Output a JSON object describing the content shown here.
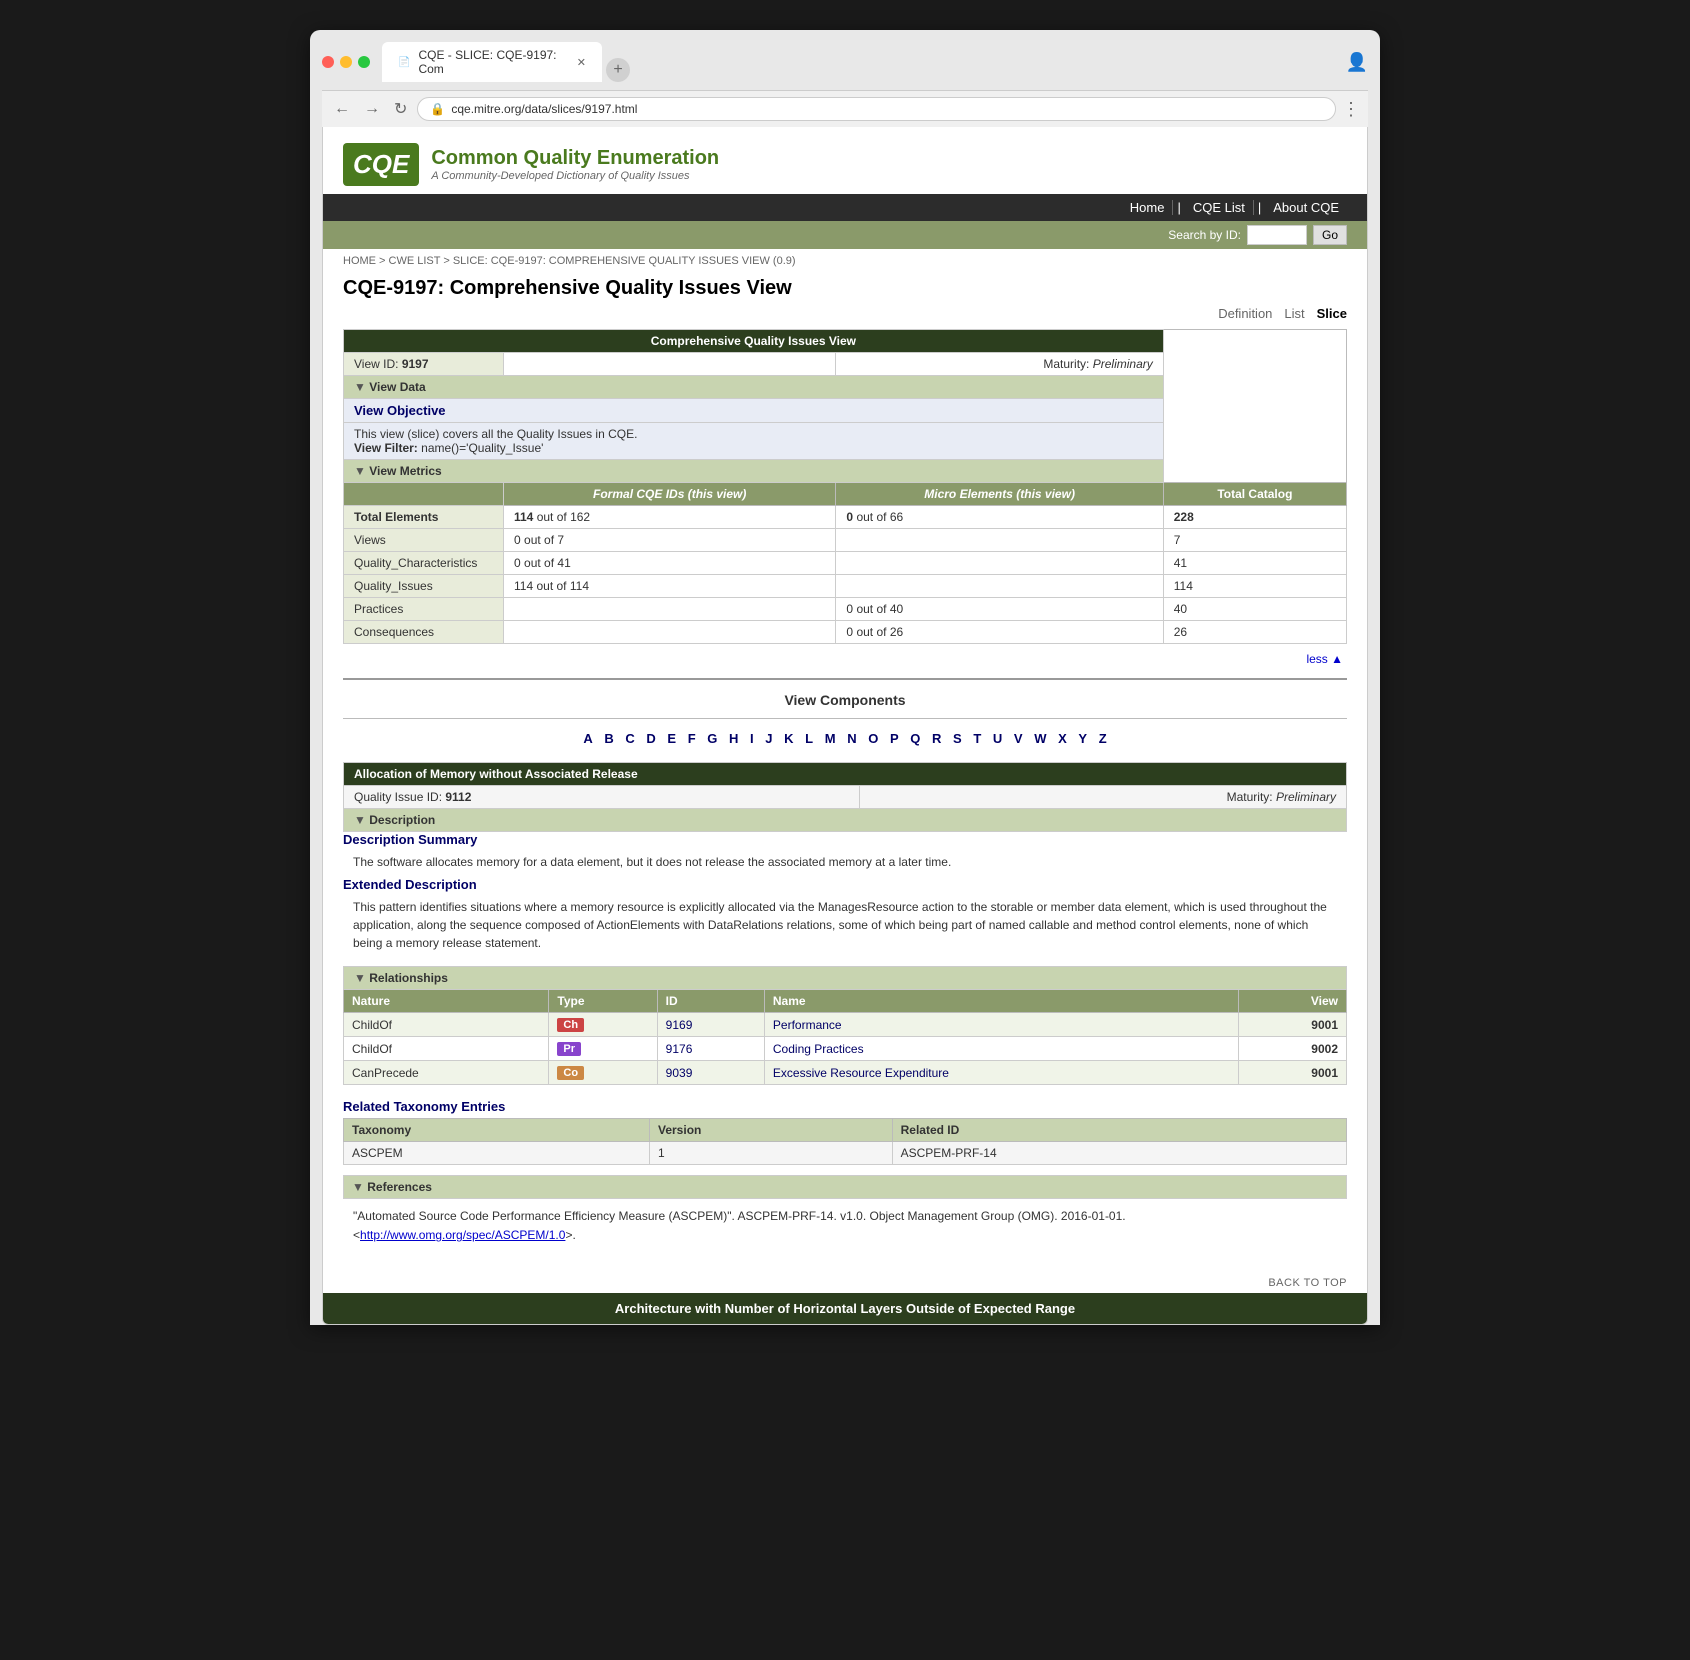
{
  "browser": {
    "tab_title": "CQE - SLICE: CQE-9197: Com",
    "url": "cqe.mitre.org/data/slices/9197.html",
    "favicon_label": "📄"
  },
  "site": {
    "logo_text": "CQE",
    "org_name": "Common Quality Enumeration",
    "org_tagline": "A Community-Developed Dictionary of Quality Issues",
    "nav_items": [
      "Home",
      "CQE List",
      "About CQE"
    ],
    "search_label": "Search by ID:",
    "search_go": "Go"
  },
  "breadcrumb": "HOME > CWE LIST > SLICE: CQE-9197: COMPREHENSIVE QUALITY ISSUES VIEW (0.9)",
  "page_title": "CQE-9197: Comprehensive Quality Issues View",
  "view_tabs": [
    "Definition",
    "List",
    "Slice"
  ],
  "main_table_title": "Comprehensive Quality Issues View",
  "view_id_label": "View ID:",
  "view_id": "9197",
  "maturity_label": "Maturity:",
  "maturity_value": "Preliminary",
  "view_data_label": "View Data",
  "view_objective_link": "View Objective",
  "view_objective_text": "This view (slice) covers all the Quality Issues in CQE.",
  "view_filter_label": "View Filter:",
  "view_filter_value": "name()='Quality_Issue'",
  "view_metrics_label": "View Metrics",
  "metrics": {
    "col_formal": "Formal CQE IDs (this view)",
    "col_micro": "Micro Elements (this view)",
    "col_total": "Total Catalog",
    "rows": [
      {
        "label": "Total Elements",
        "formal_id": "114",
        "formal_text": "out of",
        "formal_total": "162",
        "micro_id": "0",
        "micro_text": "out of",
        "micro_total": "66",
        "total": "228",
        "label_bold": true
      },
      {
        "label": "Views",
        "formal_id": "0",
        "formal_text": "out of",
        "formal_total": "7",
        "micro_id": "",
        "micro_text": "",
        "micro_total": "",
        "total": "7",
        "label_bold": false
      },
      {
        "label": "Quality_Characteristics",
        "formal_id": "0",
        "formal_text": "out of",
        "formal_total": "41",
        "micro_id": "",
        "micro_text": "",
        "micro_total": "",
        "total": "41",
        "label_bold": false
      },
      {
        "label": "Quality_Issues",
        "formal_id": "114",
        "formal_text": "out of",
        "formal_total": "114",
        "micro_id": "",
        "micro_text": "",
        "micro_total": "",
        "total": "114",
        "label_bold": false
      },
      {
        "label": "Practices",
        "formal_id": "",
        "formal_text": "",
        "formal_total": "",
        "micro_id": "0",
        "micro_text": "out of",
        "micro_total": "40",
        "total": "40",
        "label_bold": false
      },
      {
        "label": "Consequences",
        "formal_id": "",
        "formal_text": "",
        "formal_total": "",
        "micro_id": "0",
        "micro_text": "out of",
        "micro_total": "26",
        "total": "26",
        "label_bold": false
      }
    ]
  },
  "less_link": "less ▲",
  "view_components_title": "View Components",
  "alpha_letters": [
    "A",
    "B",
    "C",
    "D",
    "E",
    "F",
    "G",
    "H",
    "I",
    "J",
    "K",
    "L",
    "M",
    "N",
    "O",
    "P",
    "Q",
    "R",
    "S",
    "T",
    "U",
    "V",
    "W",
    "X",
    "Y",
    "Z"
  ],
  "qi_section": {
    "header": "Allocation of Memory without Associated Release",
    "id_label": "Quality Issue ID:",
    "id_value": "9112",
    "maturity_label": "Maturity:",
    "maturity_value": "Preliminary",
    "description_toggle": "Description",
    "desc_summary_title": "Description Summary",
    "desc_summary_text": "The software allocates memory for a data element, but it does not release the associated memory at a later time.",
    "ext_desc_title": "Extended Description",
    "ext_desc_text": "This pattern identifies situations where a memory resource is explicitly allocated via the ManagesResource action to the storable or member data element, which is used throughout the application, along the sequence composed of ActionElements with DataRelations relations, some of which being part of named callable and method control elements, none of which being a memory release statement.",
    "relationships_toggle": "Relationships",
    "rel_columns": [
      "Nature",
      "Type",
      "ID",
      "Name",
      "View"
    ],
    "relationships": [
      {
        "nature": "ChildOf",
        "type": "Ch",
        "type_class": "type-ch",
        "id": "9169",
        "name": "Performance",
        "view": "9001"
      },
      {
        "nature": "ChildOf",
        "type": "Pr",
        "type_class": "type-pr",
        "id": "9176",
        "name": "Coding Practices",
        "view": "9002"
      },
      {
        "nature": "CanPrecede",
        "type": "Co",
        "type_class": "type-co",
        "id": "9039",
        "name": "Excessive Resource Expenditure",
        "view": "9001"
      }
    ],
    "taxonomy_title": "Related Taxonomy Entries",
    "tax_columns": [
      "Taxonomy",
      "Version",
      "Related ID"
    ],
    "taxonomy_rows": [
      {
        "taxonomy": "ASCPEM",
        "version": "1",
        "related_id": "ASCPEM-PRF-14"
      }
    ],
    "references_toggle": "References",
    "reference_text": "\"Automated Source Code Performance Efficiency Measure (ASCPEM)\". ASCPEM-PRF-14. v1.0. Object Management Group (OMG). 2016-01-01.",
    "reference_link_text": "http://www.omg.org/spec/ASCPEM/1.0",
    "reference_link_suffix": ">."
  },
  "back_to_top": "BACK TO TOP",
  "next_section_title": "Architecture with Number of Horizontal Layers Outside of Expected Range"
}
